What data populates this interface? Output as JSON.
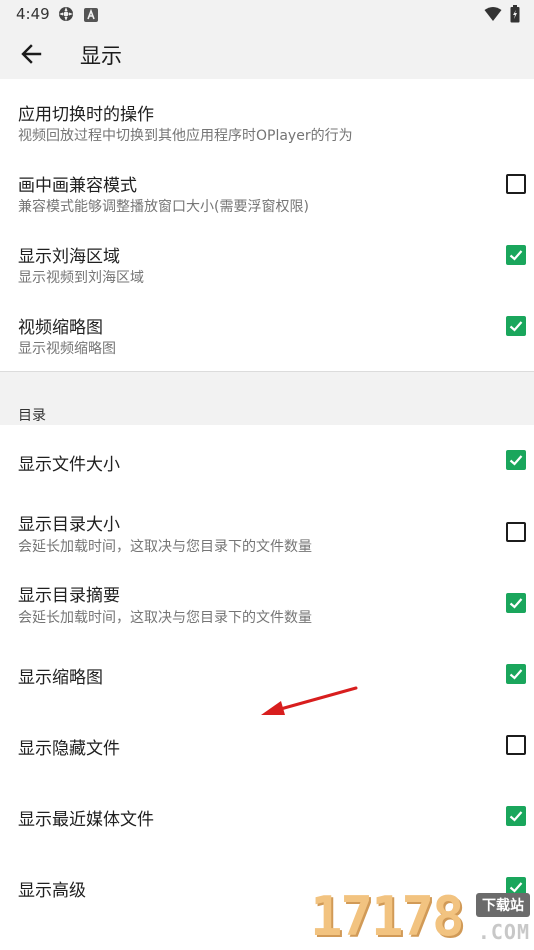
{
  "status_bar": {
    "time": "4:49",
    "icons_left": [
      "settings-gear-icon",
      "a-badge-icon"
    ],
    "icons_right": [
      "wifi-icon",
      "battery-icon"
    ]
  },
  "app_bar": {
    "back_icon": "arrow-left-icon",
    "title": "显示"
  },
  "prefs_top": [
    {
      "title": "应用切换时的操作",
      "summary": "视频回放过程中切换到其他应用程序时OPlayer的行为",
      "checkbox": null
    },
    {
      "title": "画中画兼容模式",
      "summary": "兼容模式能够调整播放窗口大小(需要浮窗权限)",
      "checkbox": false
    },
    {
      "title": "显示刘海区域",
      "summary": "显示视频到刘海区域",
      "checkbox": true
    },
    {
      "title": "视频缩略图",
      "summary": "显示视频缩略图",
      "checkbox": true
    }
  ],
  "category": {
    "title": "目录"
  },
  "prefs_dir": [
    {
      "title": "显示文件大小",
      "summary": "",
      "checkbox": true
    },
    {
      "title": "显示目录大小",
      "summary": "会延长加载时间，这取决与您目录下的文件数量",
      "checkbox": false
    },
    {
      "title": "显示目录摘要",
      "summary": "会延长加载时间，这取决与您目录下的文件数量",
      "checkbox": true
    },
    {
      "title": "显示缩略图",
      "summary": "",
      "checkbox": true
    },
    {
      "title": "显示隐藏文件",
      "summary": "",
      "checkbox": false
    },
    {
      "title": "显示最近媒体文件",
      "summary": "",
      "checkbox": true
    },
    {
      "title": "显示高级",
      "summary": "",
      "checkbox": true
    }
  ],
  "watermark": {
    "number": "17178",
    "badge": "下载站",
    "domain": ".COM"
  },
  "colors": {
    "accent": "#1aa65c",
    "bar_bg": "#f2f2f2",
    "annotation_arrow": "#d81e1e"
  }
}
